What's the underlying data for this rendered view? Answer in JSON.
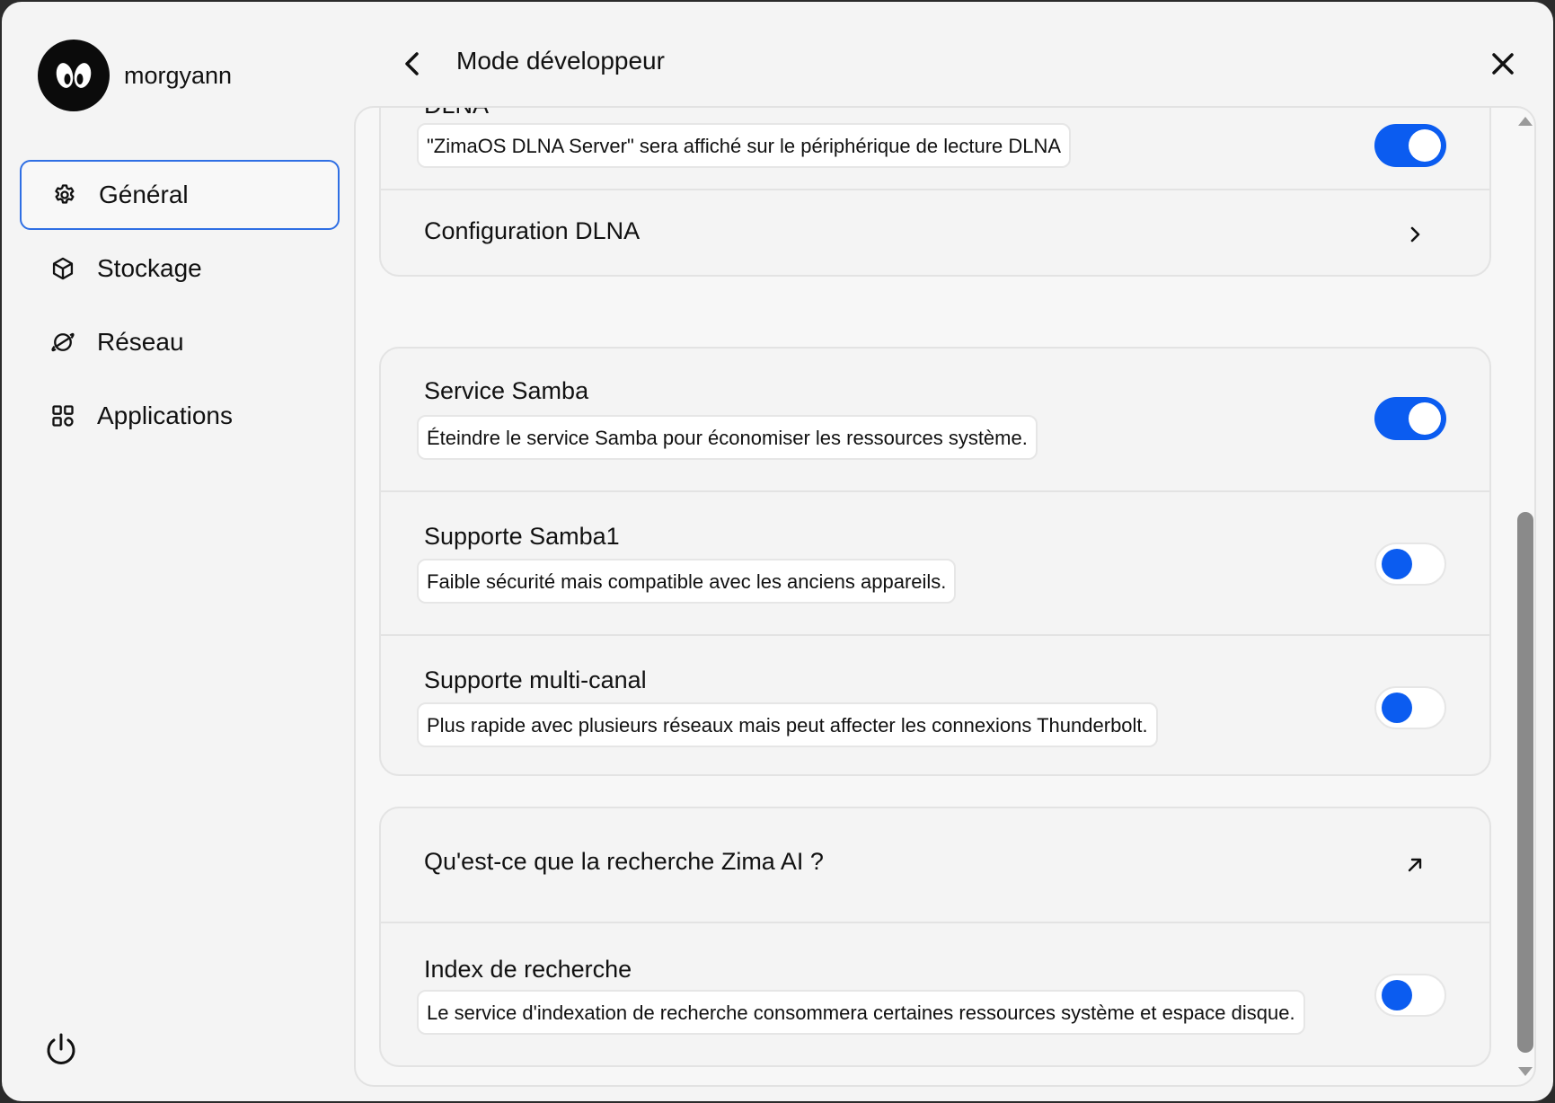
{
  "user": {
    "name": "morgyann"
  },
  "sidebar": {
    "items": [
      {
        "label": "Général",
        "icon": "gear-icon",
        "active": true
      },
      {
        "label": "Stockage",
        "icon": "cube-icon",
        "active": false
      },
      {
        "label": "Réseau",
        "icon": "planet-icon",
        "active": false
      },
      {
        "label": "Applications",
        "icon": "grid-icon",
        "active": false
      }
    ]
  },
  "header": {
    "title": "Mode développeur"
  },
  "cards": {
    "dlna": {
      "title": "DLNA",
      "desc": "\"ZimaOS DLNA Server\" sera affiché sur le périphérique de lecture DLNA",
      "toggle": "on",
      "config_label": "Configuration DLNA"
    },
    "samba": {
      "service_title": "Service Samba",
      "service_desc": "Éteindre le service Samba pour économiser les ressources système.",
      "samba1_title": "Supporte Samba1",
      "samba1_desc": "Faible sécurité mais compatible avec les anciens appareils.",
      "multichannel_title": "Supporte multi-canal",
      "multichannel_desc": "Plus rapide avec plusieurs réseaux mais peut affecter les connexions Thunderbolt."
    },
    "search": {
      "whatis_label": "Qu'est-ce que la recherche Zima AI ?",
      "index_title": "Index de recherche",
      "index_desc": "Le service d'indexation de recherche consommera certaines ressources système et espace disque."
    }
  },
  "colors": {
    "accent": "#0b5cf0",
    "active_border": "#2f6fe4"
  }
}
